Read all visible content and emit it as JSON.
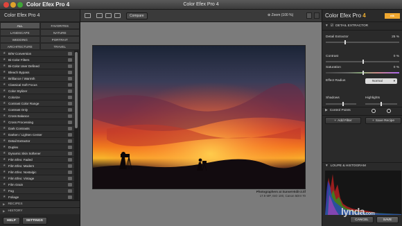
{
  "window": {
    "app_name": "Color Efex Pro 4",
    "title": "Color Efex Pro 4"
  },
  "left_panel": {
    "header": "Color Efex Pro 4",
    "categories": [
      {
        "label": "ALL",
        "active": true
      },
      {
        "label": "FAVORITES",
        "active": false
      },
      {
        "label": "LANDSCAPE",
        "active": false
      },
      {
        "label": "NATURE",
        "active": false
      },
      {
        "label": "WEDDING",
        "active": false
      },
      {
        "label": "PORTRAIT",
        "active": false
      },
      {
        "label": "ARCHITECTURE",
        "active": false
      },
      {
        "label": "TRAVEL",
        "active": false
      }
    ],
    "filters": [
      "B/W Conversion",
      "Bi-Color Filters",
      "Bi-Color User Defined",
      "Bleach Bypass",
      "Brilliance / Warmth",
      "Classical Soft Focus",
      "Color Stylizer",
      "Colorize",
      "Contrast Color Range",
      "Contrast Only",
      "Cross Balance",
      "Cross Processing",
      "Dark Contrasts",
      "Darken / Lighten Center",
      "Detail Extractor",
      "Duplex",
      "Dynamic Skin Softener",
      "Film Efex: Faded",
      "Film Efex: Modern",
      "Film Efex: Nostalgic",
      "Film Efex: Vintage",
      "Film Grain",
      "Fog",
      "Foliage"
    ],
    "recipes_label": "RECIPES",
    "history_label": "HISTORY",
    "help_label": "HELP",
    "settings_label": "SETTINGS"
  },
  "toolbar": {
    "compare_label": "Compare",
    "zoom_label": "Zoom (100 %)"
  },
  "image": {
    "caption_title": "Photographers at Sunset-Edit-2.tif",
    "caption_info": "17.9 MP, ISO 100, Canon 5DIII 70"
  },
  "right_panel": {
    "title_main": "Color Efex Pro",
    "title_version": "4",
    "badge": "nik",
    "badge_sub": "collection",
    "section_title": "DETAIL EXTRACTOR",
    "detail_extractor": {
      "label": "Detail Extractor",
      "value": "25 %",
      "level": 0.25
    },
    "contrast": {
      "label": "Contrast",
      "value": "0 %",
      "level": 0.5
    },
    "saturation": {
      "label": "Saturation",
      "value": "0 %",
      "level": 0.5
    },
    "effect_radius": {
      "label": "Effect Radius",
      "value": "Normal"
    },
    "shadows_label": "Shadows",
    "highlights_label": "Highlights",
    "control_points_label": "Control Points",
    "add_filter_label": "Add Filter",
    "save_recipe_label": "Save Recipe",
    "loupe_label": "LOUPE & HISTOGRAM",
    "cancel_label": "CANCEL",
    "save_label": "SAVE"
  },
  "watermark": {
    "text": "lynda",
    "suffix": ".com"
  }
}
